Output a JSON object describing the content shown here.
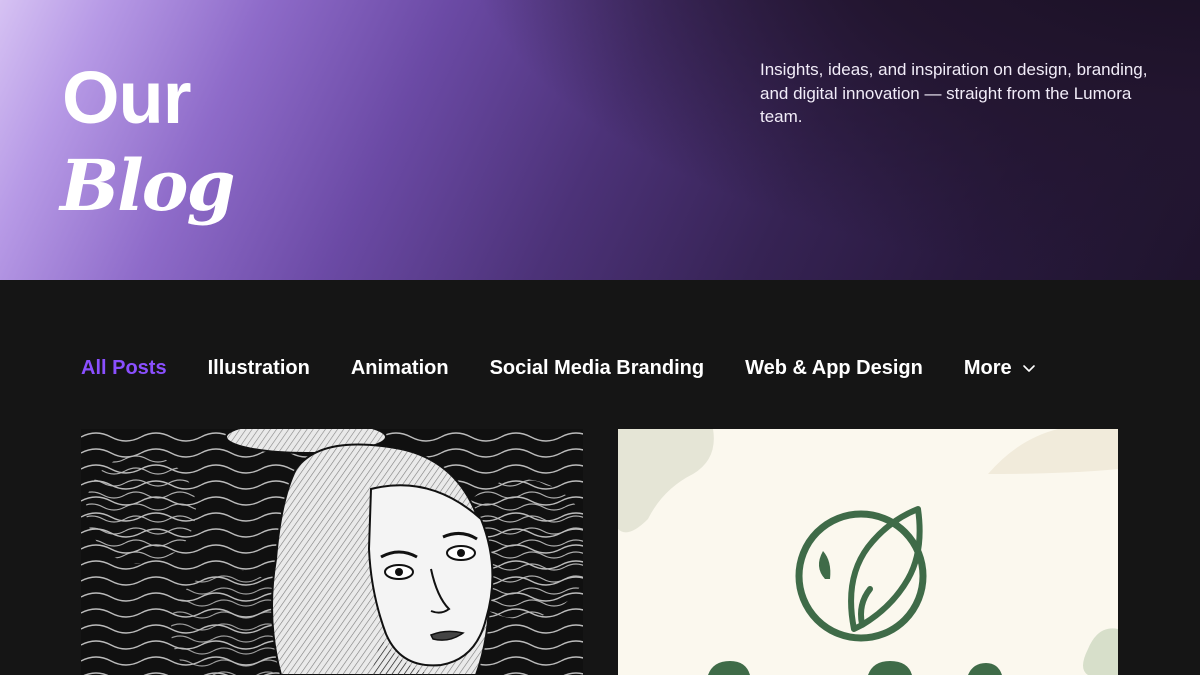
{
  "hero": {
    "title_line1": "Our",
    "title_line2": "Blog",
    "description": "Insights, ideas, and inspiration on design, branding, and digital innovation — straight from the Lumora team."
  },
  "nav": {
    "items": [
      {
        "label": "All Posts",
        "active": true
      },
      {
        "label": "Illustration"
      },
      {
        "label": "Animation"
      },
      {
        "label": "Social Media Branding"
      },
      {
        "label": "Web & App Design"
      }
    ],
    "more_label": "More"
  },
  "cards": [
    {
      "image": "engraved-portrait-illustration"
    },
    {
      "image": "leaf-logo-branding",
      "accent_color": "#3f6b48"
    }
  ],
  "colors": {
    "accent": "#8a4fff",
    "page_bg": "#151515",
    "logo_green": "#3f6b48",
    "card_cream": "#fbf8ee"
  }
}
